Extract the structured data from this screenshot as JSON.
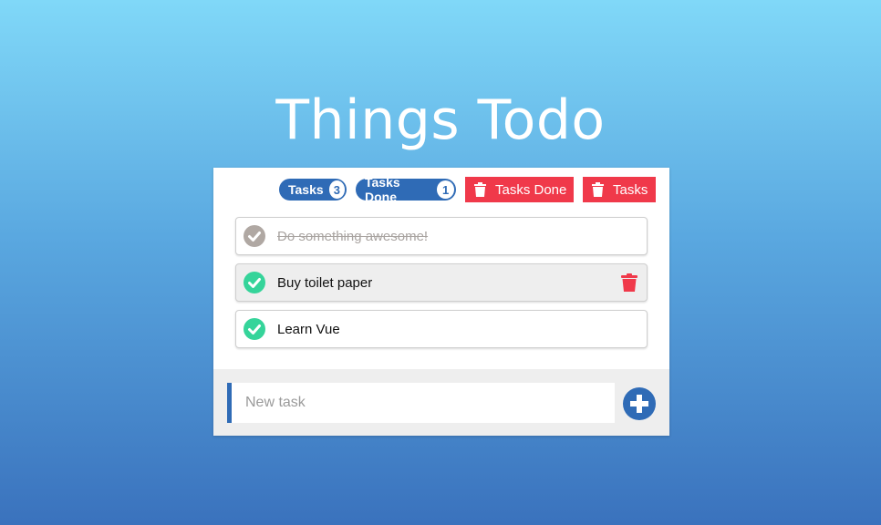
{
  "app": {
    "title": "Things Todo"
  },
  "toolbar": {
    "tasks_label": "Tasks",
    "tasks_count": "3",
    "done_label": "Tasks Done",
    "done_count": "1",
    "delete_done_label": "Tasks Done",
    "delete_tasks_label": "Tasks"
  },
  "tasks": [
    {
      "text": "Do something awesome!",
      "done": true
    },
    {
      "text": "Buy toilet paper",
      "done": false,
      "hovered": true
    },
    {
      "text": "Learn Vue",
      "done": false
    }
  ],
  "new_task": {
    "placeholder": "New task",
    "value": ""
  },
  "colors": {
    "accent": "#2f6bb6",
    "danger": "#f0394a",
    "check_active": "#35d49a",
    "check_done": "#b0a8a3"
  },
  "icons": {
    "delete": "trash-icon",
    "check": "check-circle-icon",
    "add": "plus-circle-icon"
  }
}
